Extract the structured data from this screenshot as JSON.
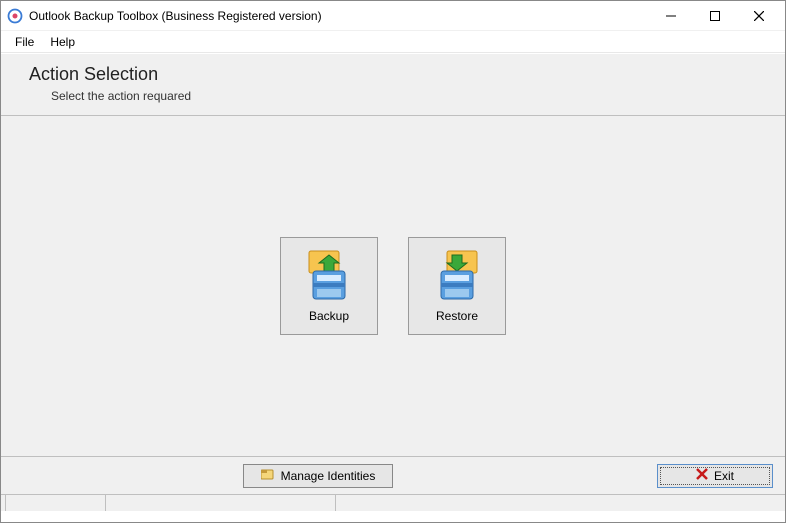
{
  "window": {
    "title": "Outlook Backup Toolbox (Business Registered version)"
  },
  "menu": {
    "file": "File",
    "help": "Help"
  },
  "header": {
    "title": "Action Selection",
    "subtitle": "Select the action requared"
  },
  "actions": {
    "backup": "Backup",
    "restore": "Restore"
  },
  "buttons": {
    "manage_identities": "Manage Identities",
    "exit": "Exit"
  }
}
